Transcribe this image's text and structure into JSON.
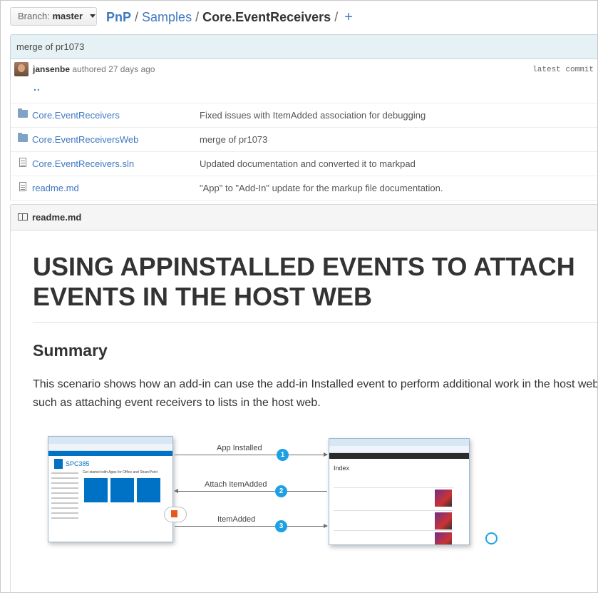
{
  "branch": {
    "label": "Branch:",
    "name": "master"
  },
  "breadcrumb": {
    "root": "PnP",
    "sep": "/",
    "mid": "Samples",
    "current": "Core.EventReceivers",
    "add": "+"
  },
  "commit": {
    "message": "merge of pr1073",
    "author": "jansenbe",
    "when": "authored 27 days ago",
    "latest": "latest commit"
  },
  "files": {
    "up": "..",
    "rows": [
      {
        "type": "folder",
        "name": "Core.EventReceivers",
        "message": "Fixed issues with ItemAdded association for debugging"
      },
      {
        "type": "folder",
        "name": "Core.EventReceiversWeb",
        "message": "merge of pr1073"
      },
      {
        "type": "file",
        "name": "Core.EventReceivers.sln",
        "message": "Updated documentation and converted it to markpad"
      },
      {
        "type": "file",
        "name": "readme.md",
        "message": "\"App\" to \"Add-In\" update for the markup file documentation."
      }
    ]
  },
  "readme": {
    "label": "readme.md",
    "title": "USING APPINSTALLED EVENTS TO ATTACH EVENTS IN THE HOST WEB",
    "summary_heading": "Summary",
    "summary_text": "This scenario shows how an add-in can use the add-in Installed event to perform additional work in the host web, such as attaching event receivers to lists in the host web.",
    "diagram": {
      "steps": [
        {
          "num": "1",
          "label": "App Installed"
        },
        {
          "num": "2",
          "label": "Attach ItemAdded"
        },
        {
          "num": "3",
          "label": "ItemAdded"
        }
      ],
      "left_site": "SPC385",
      "left_heading": "Get started with Apps for Office and SharePoint",
      "right_heading": "Index",
      "icon_left": "office-cloud-icon",
      "icon_right": "globe-icon"
    }
  },
  "colors": {
    "link": "#4078c0",
    "badge": "#1ea1e3",
    "commit_bg": "#e6f1f6"
  }
}
